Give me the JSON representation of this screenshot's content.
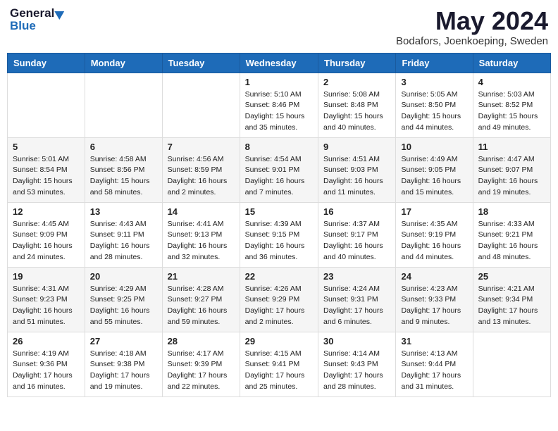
{
  "header": {
    "logo_general": "General",
    "logo_blue": "Blue",
    "month": "May 2024",
    "location": "Bodafors, Joenkoeping, Sweden"
  },
  "days_of_week": [
    "Sunday",
    "Monday",
    "Tuesday",
    "Wednesday",
    "Thursday",
    "Friday",
    "Saturday"
  ],
  "weeks": [
    [
      {
        "day": "",
        "sunrise": "",
        "sunset": "",
        "daylight": ""
      },
      {
        "day": "",
        "sunrise": "",
        "sunset": "",
        "daylight": ""
      },
      {
        "day": "",
        "sunrise": "",
        "sunset": "",
        "daylight": ""
      },
      {
        "day": "1",
        "sunrise": "5:10 AM",
        "sunset": "8:46 PM",
        "daylight": "15 hours and 35 minutes."
      },
      {
        "day": "2",
        "sunrise": "5:08 AM",
        "sunset": "8:48 PM",
        "daylight": "15 hours and 40 minutes."
      },
      {
        "day": "3",
        "sunrise": "5:05 AM",
        "sunset": "8:50 PM",
        "daylight": "15 hours and 44 minutes."
      },
      {
        "day": "4",
        "sunrise": "5:03 AM",
        "sunset": "8:52 PM",
        "daylight": "15 hours and 49 minutes."
      }
    ],
    [
      {
        "day": "5",
        "sunrise": "5:01 AM",
        "sunset": "8:54 PM",
        "daylight": "15 hours and 53 minutes."
      },
      {
        "day": "6",
        "sunrise": "4:58 AM",
        "sunset": "8:56 PM",
        "daylight": "15 hours and 58 minutes."
      },
      {
        "day": "7",
        "sunrise": "4:56 AM",
        "sunset": "8:59 PM",
        "daylight": "16 hours and 2 minutes."
      },
      {
        "day": "8",
        "sunrise": "4:54 AM",
        "sunset": "9:01 PM",
        "daylight": "16 hours and 7 minutes."
      },
      {
        "day": "9",
        "sunrise": "4:51 AM",
        "sunset": "9:03 PM",
        "daylight": "16 hours and 11 minutes."
      },
      {
        "day": "10",
        "sunrise": "4:49 AM",
        "sunset": "9:05 PM",
        "daylight": "16 hours and 15 minutes."
      },
      {
        "day": "11",
        "sunrise": "4:47 AM",
        "sunset": "9:07 PM",
        "daylight": "16 hours and 19 minutes."
      }
    ],
    [
      {
        "day": "12",
        "sunrise": "4:45 AM",
        "sunset": "9:09 PM",
        "daylight": "16 hours and 24 minutes."
      },
      {
        "day": "13",
        "sunrise": "4:43 AM",
        "sunset": "9:11 PM",
        "daylight": "16 hours and 28 minutes."
      },
      {
        "day": "14",
        "sunrise": "4:41 AM",
        "sunset": "9:13 PM",
        "daylight": "16 hours and 32 minutes."
      },
      {
        "day": "15",
        "sunrise": "4:39 AM",
        "sunset": "9:15 PM",
        "daylight": "16 hours and 36 minutes."
      },
      {
        "day": "16",
        "sunrise": "4:37 AM",
        "sunset": "9:17 PM",
        "daylight": "16 hours and 40 minutes."
      },
      {
        "day": "17",
        "sunrise": "4:35 AM",
        "sunset": "9:19 PM",
        "daylight": "16 hours and 44 minutes."
      },
      {
        "day": "18",
        "sunrise": "4:33 AM",
        "sunset": "9:21 PM",
        "daylight": "16 hours and 48 minutes."
      }
    ],
    [
      {
        "day": "19",
        "sunrise": "4:31 AM",
        "sunset": "9:23 PM",
        "daylight": "16 hours and 51 minutes."
      },
      {
        "day": "20",
        "sunrise": "4:29 AM",
        "sunset": "9:25 PM",
        "daylight": "16 hours and 55 minutes."
      },
      {
        "day": "21",
        "sunrise": "4:28 AM",
        "sunset": "9:27 PM",
        "daylight": "16 hours and 59 minutes."
      },
      {
        "day": "22",
        "sunrise": "4:26 AM",
        "sunset": "9:29 PM",
        "daylight": "17 hours and 2 minutes."
      },
      {
        "day": "23",
        "sunrise": "4:24 AM",
        "sunset": "9:31 PM",
        "daylight": "17 hours and 6 minutes."
      },
      {
        "day": "24",
        "sunrise": "4:23 AM",
        "sunset": "9:33 PM",
        "daylight": "17 hours and 9 minutes."
      },
      {
        "day": "25",
        "sunrise": "4:21 AM",
        "sunset": "9:34 PM",
        "daylight": "17 hours and 13 minutes."
      }
    ],
    [
      {
        "day": "26",
        "sunrise": "4:19 AM",
        "sunset": "9:36 PM",
        "daylight": "17 hours and 16 minutes."
      },
      {
        "day": "27",
        "sunrise": "4:18 AM",
        "sunset": "9:38 PM",
        "daylight": "17 hours and 19 minutes."
      },
      {
        "day": "28",
        "sunrise": "4:17 AM",
        "sunset": "9:39 PM",
        "daylight": "17 hours and 22 minutes."
      },
      {
        "day": "29",
        "sunrise": "4:15 AM",
        "sunset": "9:41 PM",
        "daylight": "17 hours and 25 minutes."
      },
      {
        "day": "30",
        "sunrise": "4:14 AM",
        "sunset": "9:43 PM",
        "daylight": "17 hours and 28 minutes."
      },
      {
        "day": "31",
        "sunrise": "4:13 AM",
        "sunset": "9:44 PM",
        "daylight": "17 hours and 31 minutes."
      },
      {
        "day": "",
        "sunrise": "",
        "sunset": "",
        "daylight": ""
      }
    ]
  ]
}
